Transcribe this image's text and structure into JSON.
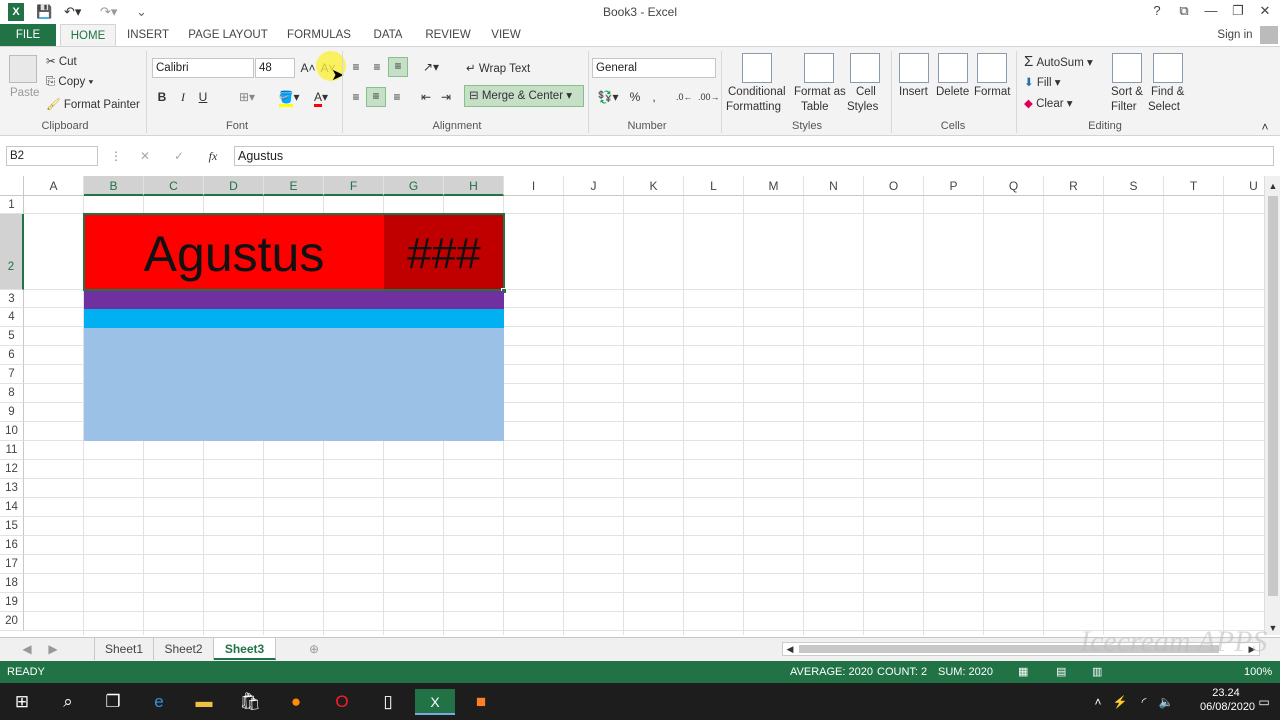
{
  "app": {
    "title": "Book3 - Excel"
  },
  "window": {
    "help": "?",
    "ribbon_opts": "⧉",
    "minimize": "—",
    "restore": "❐",
    "close": "✕",
    "sign_in": "Sign in"
  },
  "quick_access": {
    "app_icon": "excel-logo",
    "save": "save-icon",
    "undo": "undo-icon",
    "redo": "redo-icon"
  },
  "tabs": [
    "FILE",
    "HOME",
    "INSERT",
    "PAGE LAYOUT",
    "FORMULAS",
    "DATA",
    "REVIEW",
    "VIEW"
  ],
  "ribbon": {
    "clipboard": {
      "paste": "Paste",
      "cut": "Cut",
      "copy": "Copy",
      "format_painter": "Format Painter",
      "label": "Clipboard"
    },
    "font": {
      "name": "Calibri",
      "size": "48",
      "bold": "B",
      "italic": "I",
      "underline": "U",
      "label": "Font"
    },
    "alignment": {
      "wrap_text": "Wrap Text",
      "merge_center": "Merge & Center",
      "label": "Alignment"
    },
    "number": {
      "format": "General",
      "percent": "%",
      "comma": ",",
      "label": "Number"
    },
    "styles": {
      "conditional": "Conditional",
      "conditional2": "Formatting",
      "format_as": "Format as",
      "format_as2": "Table",
      "cell": "Cell",
      "cell2": "Styles",
      "label": "Styles"
    },
    "cells": {
      "insert": "Insert",
      "delete": "Delete",
      "format": "Format",
      "label": "Cells"
    },
    "editing": {
      "autosum": "AutoSum",
      "fill": "Fill",
      "clear": "Clear",
      "sort_filter": "Sort &",
      "sort_filter2": "Filter",
      "find_select": "Find &",
      "find_select2": "Select",
      "label": "Editing"
    }
  },
  "formula_bar": {
    "name_box": "B2",
    "fx": "fx",
    "value": "Agustus",
    "cancel": "✕",
    "enter": "✓"
  },
  "grid": {
    "columns": [
      "A",
      "B",
      "C",
      "D",
      "E",
      "F",
      "G",
      "H",
      "I",
      "J",
      "K",
      "L",
      "M",
      "N",
      "O",
      "P",
      "Q",
      "R",
      "S",
      "T",
      "U"
    ],
    "rows": [
      "1",
      "2",
      "3",
      "4",
      "5",
      "6",
      "7",
      "8",
      "9",
      "10",
      "11",
      "12",
      "13",
      "14",
      "15",
      "16",
      "17",
      "18",
      "19",
      "20"
    ],
    "merged_text": "Agustus",
    "overflow_text": "###",
    "colors": {
      "red": "#ff0000",
      "dark_red": "#c00000",
      "purple": "#7030a0",
      "cyan": "#00b0f0",
      "light_blue": "#9bc2e6"
    }
  },
  "sheets": [
    "Sheet1",
    "Sheet2",
    "Sheet3"
  ],
  "active_sheet": "Sheet3",
  "status": {
    "mode": "READY",
    "average": "AVERAGE: 2020",
    "count": "COUNT: 2",
    "sum": "SUM: 2020",
    "zoom": "100%"
  },
  "watermark": "Icecream APPS",
  "taskbar": {
    "time": "23.24",
    "date": "06/08/2020"
  }
}
